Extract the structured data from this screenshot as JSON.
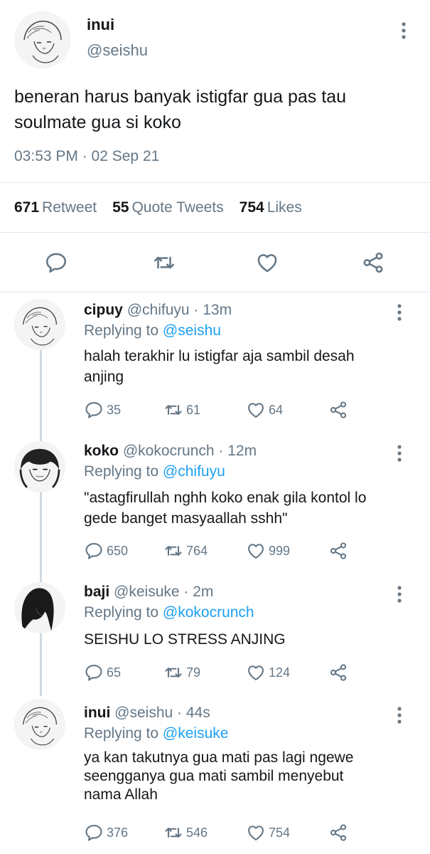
{
  "main": {
    "author_name": "inui",
    "author_handle": "@seishu",
    "text_line1": "beneran harus banyak istigfar gua pas tau",
    "text_line2": "soulmate gua si koko",
    "timestamp": "03:53 PM · 02 Sep 21",
    "retweets_count": "671",
    "retweets_label": "Retweet",
    "quotes_count": "55",
    "quotes_label": "Quote Tweets",
    "likes_count": "754",
    "likes_label": "Likes"
  },
  "replies": [
    {
      "name": "cipuy",
      "handle": "@chifuyu",
      "time": "· 13m",
      "replying_prefix": "Replying to",
      "replying_to": "@seishu",
      "line1": "halah terakhir lu istigfar aja sambil desah",
      "line2": "anjing",
      "line3": "",
      "replies": "35",
      "retweets": "61",
      "likes": "64"
    },
    {
      "name": "koko",
      "handle": "@kokocrunch",
      "time": "· 12m",
      "replying_prefix": "Replying to",
      "replying_to": "@chifuyu",
      "line1": "\"astagfirullah nghh koko enak gila kontol lo",
      "line2": "gede banget masyaallah sshh\"",
      "line3": "",
      "replies": "650",
      "retweets": "764",
      "likes": "999"
    },
    {
      "name": "baji",
      "handle": "@keisuke",
      "time": "· 2m",
      "replying_prefix": "Replying to",
      "replying_to": "@kokocrunch",
      "line1": "SEISHU LO STRESS ANJING",
      "line2": "",
      "line3": "",
      "replies": "65",
      "retweets": "79",
      "likes": "124"
    },
    {
      "name": "inui",
      "handle": "@seishu",
      "time": "· 44s",
      "replying_prefix": "Replying to",
      "replying_to": "@keisuke",
      "line1": "ya kan takutnya gua mati pas lagi ngewe",
      "line2": "seengganya gua mati sambil menyebut",
      "line3": "nama Allah",
      "replies": "376",
      "retweets": "546",
      "likes": "754"
    }
  ],
  "colors": {
    "link": "#1da1f2",
    "muted": "#657786",
    "divider": "#e1e8ed"
  },
  "icons": [
    "more-vertical-icon",
    "reply-icon",
    "retweet-icon",
    "like-icon",
    "share-icon"
  ]
}
